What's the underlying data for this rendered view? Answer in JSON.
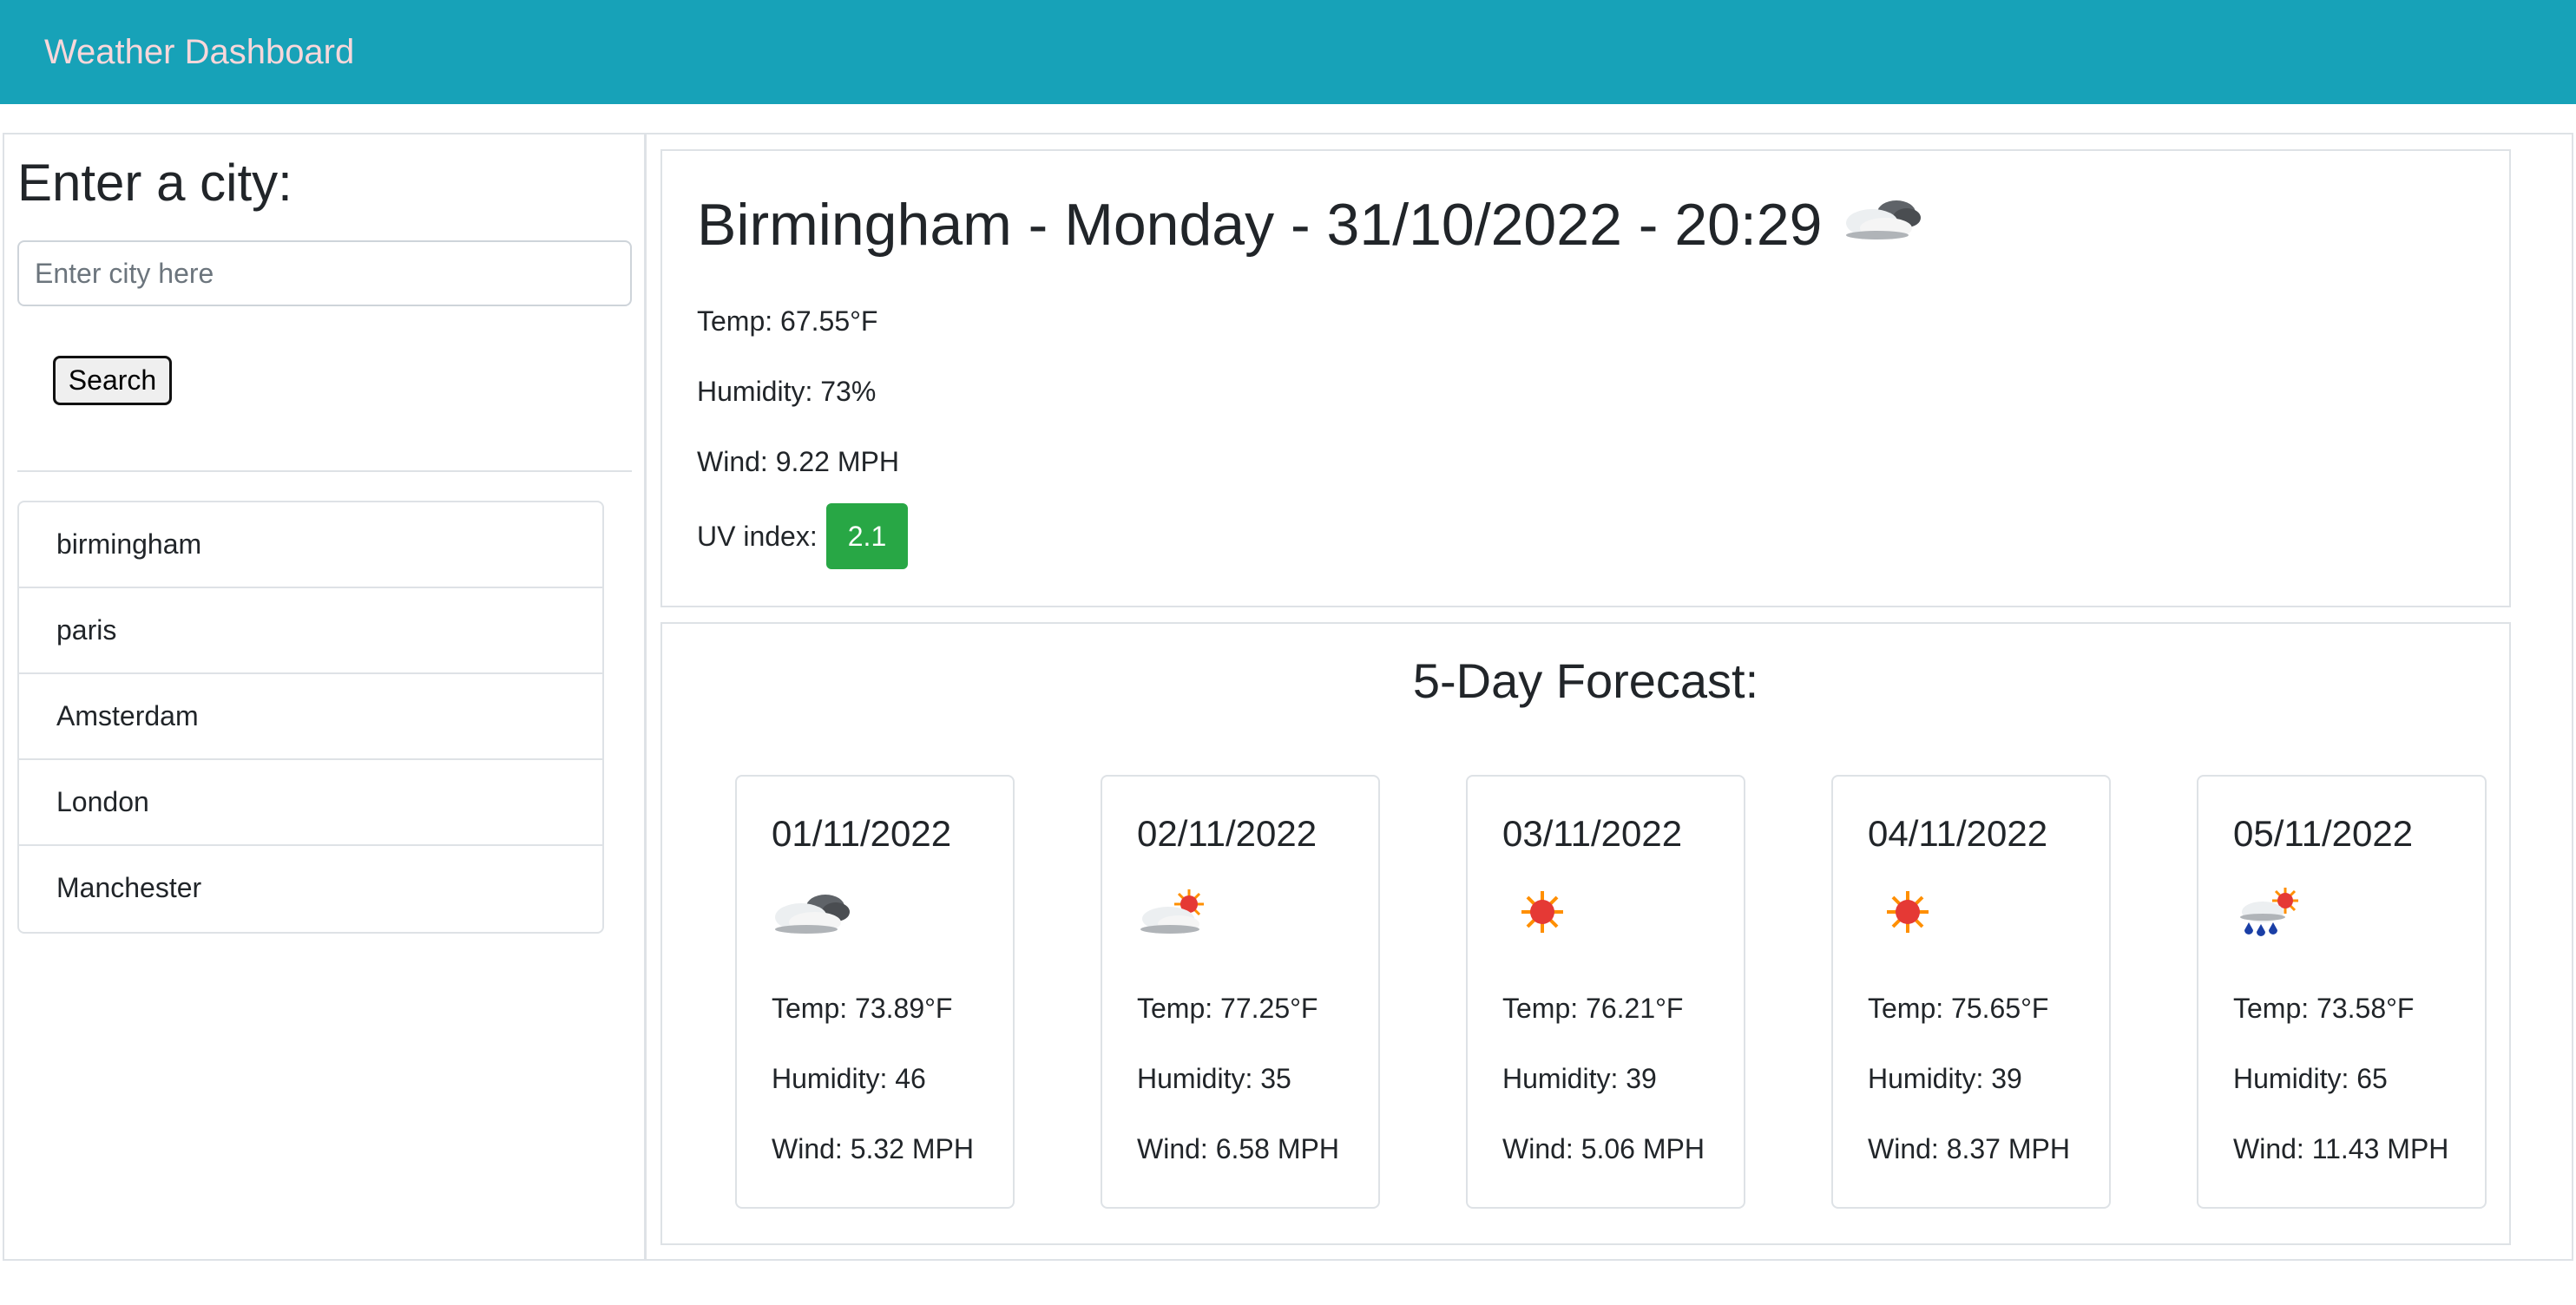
{
  "header": {
    "brand": "Weather Dashboard"
  },
  "sidebar": {
    "title": "Enter a city:",
    "input_placeholder": "Enter city here",
    "input_value": "",
    "search_label": "Search",
    "history": [
      "birmingham",
      "paris",
      "Amsterdam",
      "London",
      "Manchester"
    ]
  },
  "current": {
    "title": "Birmingham - Monday - 31/10/2022 - 20:29",
    "icon": "cloudy-icon",
    "temp": "Temp: 67.55°F",
    "humidity": "Humidity: 73%",
    "wind": "Wind: 9.22 MPH",
    "uv_label": "UV index:",
    "uv_value": "2.1",
    "uv_color": "#28a745"
  },
  "forecast": {
    "title": "5-Day Forecast:",
    "days": [
      {
        "date": "01/11/2022",
        "icon": "cloudy-icon",
        "temp": "Temp: 73.89°F",
        "humidity": "Humidity: 46",
        "wind": "Wind: 5.32 MPH"
      },
      {
        "date": "02/11/2022",
        "icon": "partly-cloudy-icon",
        "temp": "Temp: 77.25°F",
        "humidity": "Humidity: 35",
        "wind": "Wind: 6.58 MPH"
      },
      {
        "date": "03/11/2022",
        "icon": "sun-icon",
        "temp": "Temp: 76.21°F",
        "humidity": "Humidity: 39",
        "wind": "Wind: 5.06 MPH"
      },
      {
        "date": "04/11/2022",
        "icon": "sun-icon",
        "temp": "Temp: 75.65°F",
        "humidity": "Humidity: 39",
        "wind": "Wind: 8.37 MPH"
      },
      {
        "date": "05/11/2022",
        "icon": "rain-sun-icon",
        "temp": "Temp: 73.58°F",
        "humidity": "Humidity: 65",
        "wind": "Wind: 11.43 MPH"
      }
    ]
  },
  "colors": {
    "navbar": "#17a2b8",
    "brand_text": "#f8d7da",
    "uv_badge": "#28a745"
  }
}
